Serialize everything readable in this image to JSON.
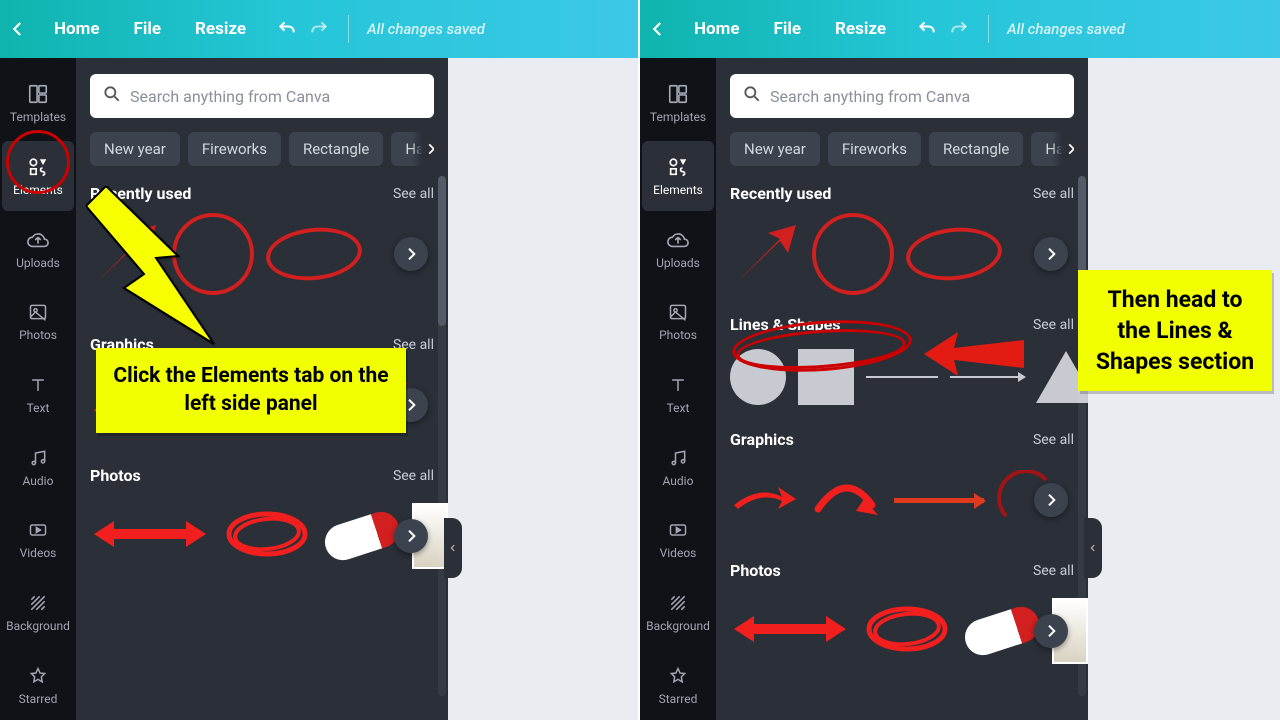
{
  "topbar": {
    "home": "Home",
    "file": "File",
    "resize": "Resize",
    "saved": "All changes saved"
  },
  "rail": {
    "templates": "Templates",
    "elements": "Elements",
    "uploads": "Uploads",
    "photos": "Photos",
    "text": "Text",
    "audio": "Audio",
    "videos": "Videos",
    "background": "Background",
    "starred": "Starred"
  },
  "panel": {
    "search_placeholder": "Search anything from Canva",
    "chips": {
      "c0": "New year",
      "c1": "Fireworks",
      "c2": "Rectangle",
      "c3": "Happ"
    },
    "sections": {
      "recent": {
        "title": "Recently used",
        "seeall": "See all"
      },
      "lines": {
        "title": "Lines & Shapes",
        "seeall": "See all"
      },
      "graphics": {
        "title": "Graphics",
        "seeall": "See all"
      },
      "photos": {
        "title": "Photos",
        "seeall": "See all"
      }
    }
  },
  "annotations": {
    "left_box": "Click the Elements tab on the left side panel",
    "right_box": "Then head to the Lines & Shapes section"
  }
}
